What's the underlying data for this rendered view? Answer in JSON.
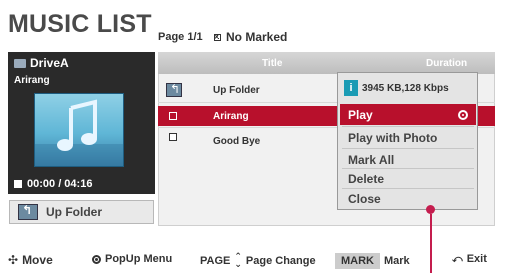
{
  "app": {
    "title": "MUSIC LIST"
  },
  "header": {
    "page": "Page 1/1",
    "marked": "No Marked"
  },
  "left_panel": {
    "drive": "DriveA",
    "song": "Arirang",
    "time": "00:00 / 04:16",
    "up_folder": "Up Folder",
    "icons": {
      "drive": "usb-drive-icon",
      "album_art": "music-note-icon",
      "folder": "up-folder-icon"
    }
  },
  "list": {
    "columns": [
      "Title",
      "Duration"
    ],
    "rows": [
      {
        "name": "Up Folder",
        "type": "folder",
        "selected": false
      },
      {
        "name": "Arirang",
        "type": "file",
        "selected": true
      },
      {
        "name": "Good Bye",
        "type": "file",
        "selected": false
      }
    ]
  },
  "popup": {
    "info": "3945 KB,128 Kbps",
    "info_icon": "i",
    "items": [
      "Play",
      "Play with Photo",
      "Mark All",
      "Delete",
      "Close"
    ],
    "selected_index": 0
  },
  "bottom": {
    "move": "Move",
    "popup_menu": "PopUp Menu",
    "page": "PAGE",
    "page_change": "Page Change",
    "mark_key": "MARK",
    "mark": "Mark",
    "exit": "Exit"
  },
  "colors": {
    "selection": "#b8102c",
    "info_accent": "#1a9bb4",
    "pointer": "#c41d4e"
  }
}
